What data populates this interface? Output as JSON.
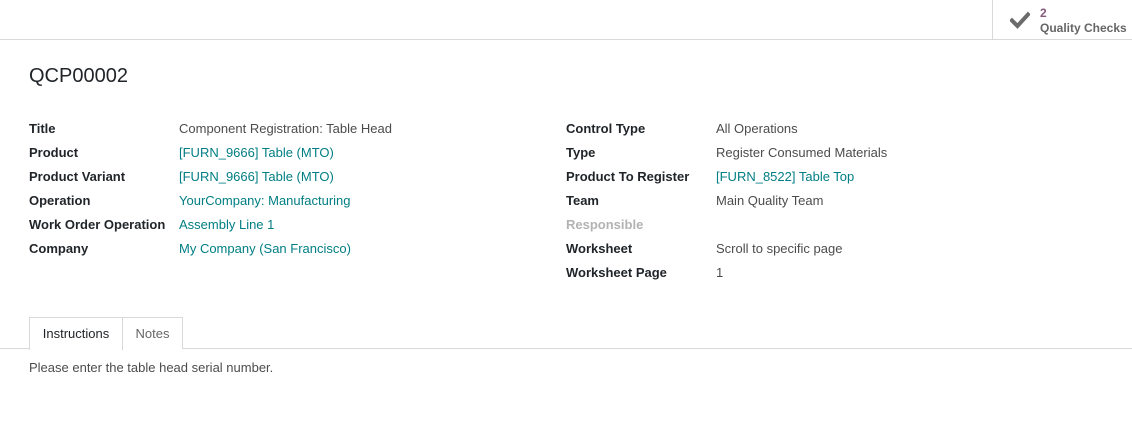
{
  "smart_button": {
    "value": "2",
    "label": "Quality Checks",
    "icon": "check-icon"
  },
  "record": {
    "name": "QCP00002"
  },
  "left_fields": [
    {
      "label": "Title",
      "value": "Component Registration: Table Head"
    },
    {
      "label": "Product",
      "value": "[FURN_9666] Table (MTO)"
    },
    {
      "label": "Product Variant",
      "value": "[FURN_9666] Table (MTO)"
    },
    {
      "label": "Operation",
      "value": "YourCompany: Manufacturing"
    },
    {
      "label": "Work Order Operation",
      "value": "Assembly Line 1"
    },
    {
      "label": "Company",
      "value": "My Company (San Francisco)"
    }
  ],
  "right_fields": [
    {
      "label": "Control Type",
      "value": "All Operations"
    },
    {
      "label": "Type",
      "value": "Register Consumed Materials"
    },
    {
      "label": "Product To Register",
      "value": "[FURN_8522] Table Top"
    },
    {
      "label": "Team",
      "value": "Main Quality Team"
    },
    {
      "label": "Responsible",
      "value": ""
    },
    {
      "label": "Worksheet",
      "value": "Scroll to specific page"
    },
    {
      "label": "Worksheet Page",
      "value": "1"
    }
  ],
  "tabs": [
    {
      "label": "Instructions",
      "active": true
    },
    {
      "label": "Notes",
      "active": false
    }
  ],
  "instructions": {
    "text": "Please enter the table head serial number."
  },
  "colors": {
    "link": "#017e84",
    "smart_value": "#875a7b",
    "muted_label": "#b3b3b3"
  }
}
